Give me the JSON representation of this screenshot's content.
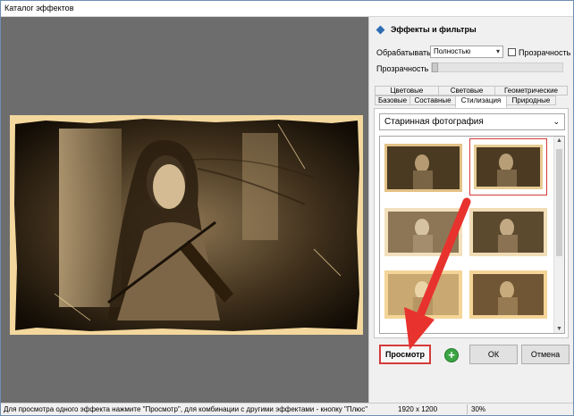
{
  "window": {
    "title": "Каталог эффектов"
  },
  "panel": {
    "title": "Эффекты и фильтры",
    "process_label": "Обрабатывать",
    "process_value": "Полностью",
    "transparency_checkbox_label": "Прозрачность",
    "transparency_slider_label": "Прозрачность",
    "transparency_value_pct": 0
  },
  "tabs": {
    "row1": [
      "Цветовые",
      "Световые",
      "Геометрические"
    ],
    "row2": [
      "Базовые",
      "Составные",
      "Стилизация",
      "Природные"
    ],
    "active": "Стилизация"
  },
  "effect_select": {
    "value": "Старинная фотография"
  },
  "gallery": {
    "selected_index": 1,
    "count_visible": 6
  },
  "buttons": {
    "preview": "Просмотр",
    "plus": "+",
    "ok": "ОК",
    "cancel": "Отмена"
  },
  "status": {
    "hint": "Для просмотра одного эффекта нажмите \"Просмотр\", для комбинации с другими эффектами - кнопку \"Плюс\"",
    "resolution": "1920 x 1200",
    "zoom": "30%"
  },
  "colors": {
    "accent_red": "#d43a3a",
    "sepia_light": "#f3d79d",
    "sepia_dark": "#3a2a14",
    "plus_green": "#3ba544"
  },
  "icons": {
    "panel_icon": "diamond-icon",
    "plus_icon": "plus-circle-icon",
    "dropdown": "chevron-down-icon"
  }
}
